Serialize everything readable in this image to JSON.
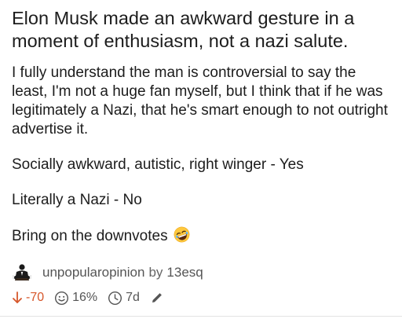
{
  "post": {
    "title": "Elon Musk made an awkward gesture in a moment of enthusiasm, not a nazi salute.",
    "paragraphs": [
      "I fully understand the man is controversial to say the least, I'm not a huge fan myself, but I think that if he was legitimately a Nazi, that he's smart enough to not outright advertise it.",
      "Socially awkward, autistic, right winger - Yes",
      "Literally a Nazi - No",
      "Bring on the downvotes"
    ],
    "emoji": "rofl-emoji"
  },
  "meta": {
    "subreddit": "unpopularopinion",
    "by": "by",
    "user": "13esq"
  },
  "stats": {
    "score": "-70",
    "upvote_ratio": "16%",
    "age": "7d"
  },
  "colors": {
    "downvote": "#d6572b",
    "text": "#1c1c1c",
    "muted": "#666666"
  }
}
